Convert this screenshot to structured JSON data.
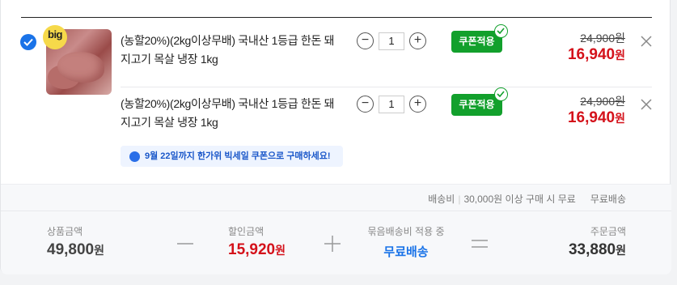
{
  "items": [
    {
      "badge": "big",
      "title": "(농할20%)(2kg이상무배) 국내산 1등급 한돈 돼지고기 목살 냉장 1kg",
      "qty": "1",
      "coupon_label": "쿠폰적용",
      "original_price": "24,900원",
      "sale_price": "16,940",
      "sale_unit": "원"
    },
    {
      "title": "(농할20%)(2kg이상무배) 국내산 1등급 한돈 돼지고기 목살 냉장 1kg",
      "qty": "1",
      "coupon_label": "쿠폰적용",
      "original_price": "24,900원",
      "sale_price": "16,940",
      "sale_unit": "원"
    }
  ],
  "notice": "9월 22일까지 한가위 빅세일 쿠폰으로 구매하세요!",
  "shipping": {
    "label": "배송비",
    "condition": "30,000원 이상 구매 시 무료",
    "fee": "무료배송"
  },
  "summary": {
    "product_label": "상품금액",
    "product_value": "49,800",
    "discount_label": "할인금액",
    "discount_value": "15,920",
    "bundle_label": "묶음배송비 적용 중",
    "bundle_value": "무료배송",
    "order_label": "주문금액",
    "order_value": "33,880",
    "unit": "원"
  },
  "colors": {
    "accent_blue": "#1a73e8",
    "coupon_green": "#12a02c",
    "price_red": "#d4111a"
  },
  "icons": {
    "select": "checkmark-circle-icon",
    "minus": "minus-icon",
    "plus": "plus-icon",
    "remove": "close-icon",
    "coupon_applied": "check-icon",
    "notice": "info-icon"
  }
}
